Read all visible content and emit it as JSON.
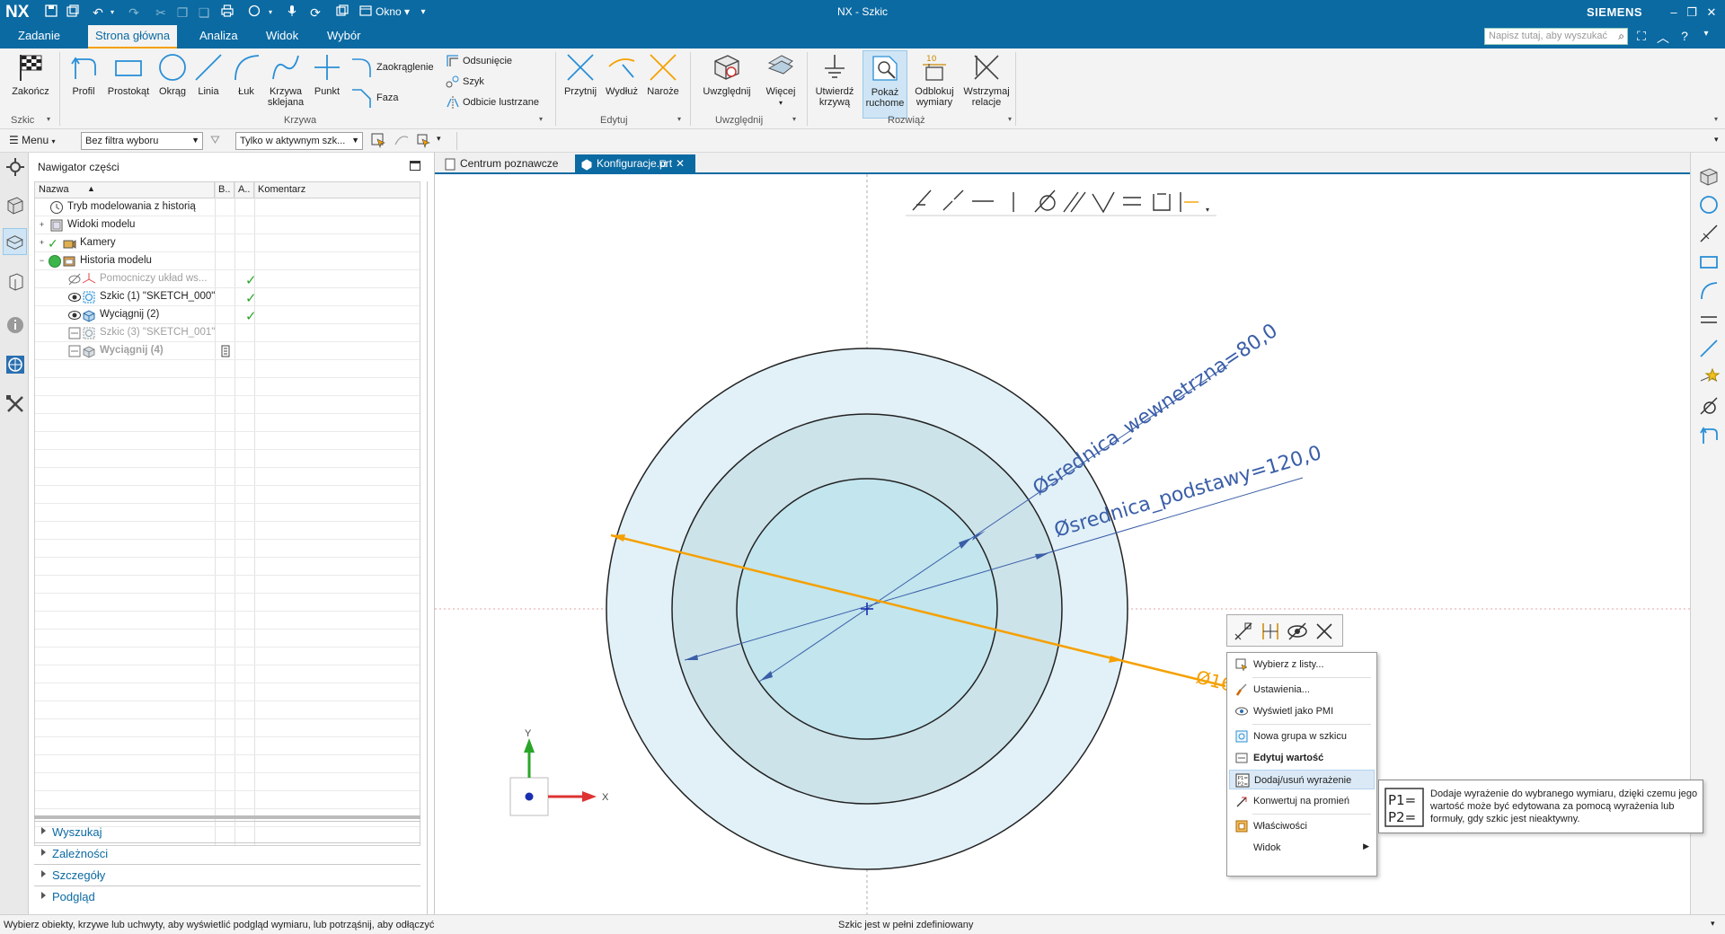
{
  "titlebar": {
    "app": "NX",
    "okno_label": "Okno",
    "window_title": "NX - Szkic",
    "brand": "SIEMENS"
  },
  "ribbon_tabs": [
    "Zadanie",
    "Strona główna",
    "Analiza",
    "Widok",
    "Wybór"
  ],
  "search_placeholder": "Napisz tutaj, aby wyszukać",
  "ribbon": {
    "zakoncz": "Zakończ",
    "szkic_group": "Szkic",
    "profil": "Profil",
    "prostokat": "Prostokąt",
    "okrag": "Okrąg",
    "linia": "Linia",
    "luk": "Łuk",
    "krzywa": "Krzywa",
    "sklejana": "sklejana",
    "punkt": "Punkt",
    "zaokraglenie": "Zaokrąglenie",
    "faza": "Faza",
    "odsuniecie": "Odsunięcie",
    "szyk": "Szyk",
    "odbicie": "Odbicie lustrzane",
    "krzywa_group": "Krzywa",
    "przytnij": "Przytnij",
    "wydluz": "Wydłuż",
    "naroze": "Naroże",
    "edytuj_group": "Edytuj",
    "uwzglednij": "Uwzględnij",
    "wiecej": "Więcej",
    "uwzglednij_group": "Uwzględnij",
    "utwierdz1": "Utwierdź",
    "utwierdz2": "krzywą",
    "pokaz1": "Pokaż",
    "pokaz2": "ruchome",
    "odblokuj1": "Odblokuj",
    "odblokuj2": "wymiary",
    "wstrzymaj1": "Wstrzymaj",
    "wstrzymaj2": "relacje",
    "rozwiaz_group": "Rozwiąż"
  },
  "selbar": {
    "menu": "Menu",
    "filter": "Bez filtra wyboru",
    "scope": "Tylko w aktywnym szk..."
  },
  "navigator": {
    "title": "Nawigator części",
    "columns": [
      "Nazwa",
      "B..",
      "A..",
      "Komentarz"
    ],
    "rows": [
      {
        "label": "Tryb modelowania z historią"
      },
      {
        "label": "Widoki modelu"
      },
      {
        "label": "Kamery"
      },
      {
        "label": "Historia modelu"
      },
      {
        "label": "Pomocniczy układ ws..."
      },
      {
        "label": "Szkic (1) \"SKETCH_000\""
      },
      {
        "label": "Wyciągnij (2)"
      },
      {
        "label": "Szkic (3) \"SKETCH_001\""
      },
      {
        "label": "Wyciągnij (4)"
      }
    ],
    "panels": [
      "Wyszukaj",
      "Zależności",
      "Szczegóły",
      "Podgląd"
    ]
  },
  "doctabs": [
    "Centrum poznawcze",
    "Konfiguracje.prt"
  ],
  "canvas": {
    "dim_inner": "Øsrednica_wewnetrzna=80,0",
    "dim_outer": "Øsrednica_podstawy=120,0",
    "dim_active": "Ø160",
    "axis_y": "Y",
    "axis_x": "X"
  },
  "context_menu": [
    "Wybierz z listy...",
    "Ustawienia...",
    "Wyświetl jako PMI",
    "Nowa grupa w szkicu",
    "Edytuj wartość",
    "Dodaj/usuń wyrażenie",
    "Konwertuj na promień",
    "Właściwości",
    "Widok"
  ],
  "tooltip": {
    "line1": "P1=",
    "line2": "P2=",
    "text": "Dodaje wyrażenie do wybranego wymiaru, dzięki czemu jego wartość może być edytowana za pomocą wyrażenia lub formuły, gdy szkic jest nieaktywny."
  },
  "status": {
    "left": "Wybierz obiekty, krzywe lub uchwyty, aby wyświetlić podgląd wymiaru, lub potrząśnij, aby odłączyć",
    "center": "Szkic jest w pełni zdefiniowany"
  },
  "colors": {
    "accent": "#0b6aa2",
    "orange": "#f5a000",
    "dim_blue": "#3a5ea8",
    "fill_outer": "#e2f1f8",
    "fill_mid": "#cde3ea",
    "fill_inner": "#c2e5ee"
  }
}
